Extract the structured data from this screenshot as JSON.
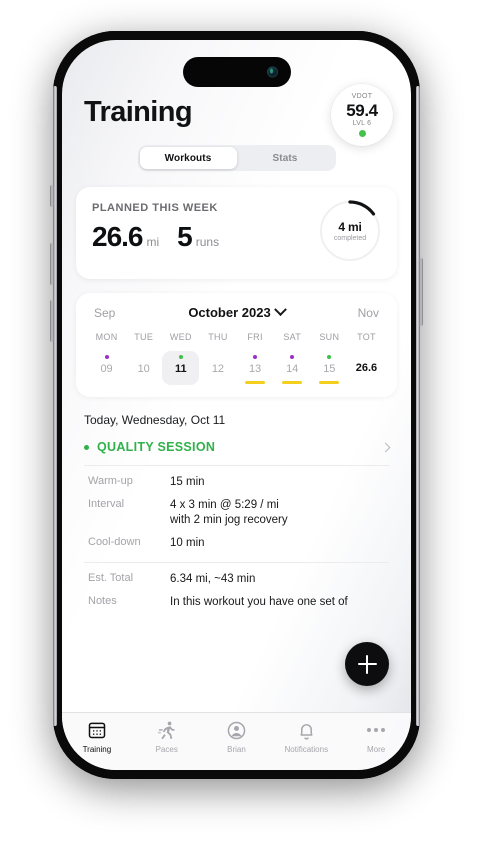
{
  "app": {
    "header": {
      "title": "Training",
      "vdot": {
        "label": "VDOT",
        "value": "59.4",
        "level": "LVL 6",
        "status_color": "#44c14b"
      }
    },
    "segmented": {
      "tabs": [
        {
          "label": "Workouts",
          "active": true
        },
        {
          "label": "Stats",
          "active": false
        }
      ]
    },
    "planned": {
      "label": "PLANNED THIS WEEK",
      "distance": "26.6",
      "distance_unit": "mi",
      "runs": "5",
      "runs_unit": "runs",
      "ring": {
        "value": "4 mi",
        "sub": "completed",
        "percent": 15,
        "arc_color": "#111214",
        "track_color": "#f0f0f2"
      }
    },
    "calendar": {
      "prev_month": "Sep",
      "current_month": "October 2023",
      "next_month": "Nov",
      "dow": [
        "MON",
        "TUE",
        "WED",
        "THU",
        "FRI",
        "SAT",
        "SUN",
        "TOT"
      ],
      "days": [
        {
          "num": "09",
          "dot": "purple",
          "bar": false,
          "selected": false
        },
        {
          "num": "10",
          "dot": "none",
          "bar": false,
          "selected": false
        },
        {
          "num": "11",
          "dot": "green",
          "bar": false,
          "selected": true
        },
        {
          "num": "12",
          "dot": "none",
          "bar": false,
          "selected": false
        },
        {
          "num": "13",
          "dot": "purple",
          "bar": true,
          "selected": false
        },
        {
          "num": "14",
          "dot": "purple",
          "bar": true,
          "selected": false
        },
        {
          "num": "15",
          "dot": "green",
          "bar": true,
          "selected": false
        }
      ],
      "total": "26.6",
      "dot_colors": {
        "purple": "#9b30c8",
        "green": "#3fc04a",
        "bar": "#f5cf1e"
      }
    },
    "detail": {
      "date_line": "Today, Wednesday, Oct 11",
      "session_title": "QUALITY SESSION",
      "session_color": "#2fb24a",
      "rows": [
        {
          "key": "Warm-up",
          "value": "15 min",
          "sub": ""
        },
        {
          "key": "Interval",
          "value": "4 x 3 min @ 5:29 / mi",
          "sub": "with 2 min jog recovery"
        },
        {
          "key": "Cool-down",
          "value": "10 min",
          "sub": ""
        },
        {
          "key": "Est. Total",
          "value": "6.34 mi, ~43 min",
          "sub": ""
        },
        {
          "key": "Notes",
          "value": "In this workout you have one set of",
          "sub": ""
        }
      ]
    },
    "fab": {
      "label": "+"
    },
    "tabbar": {
      "items": [
        {
          "label": "Training",
          "icon": "calendar-icon",
          "active": true
        },
        {
          "label": "Paces",
          "icon": "runner-icon",
          "active": false
        },
        {
          "label": "Brian",
          "icon": "person-icon",
          "active": false
        },
        {
          "label": "Notifications",
          "icon": "bell-icon",
          "active": false
        },
        {
          "label": "More",
          "icon": "ellipsis-icon",
          "active": false
        }
      ]
    }
  }
}
